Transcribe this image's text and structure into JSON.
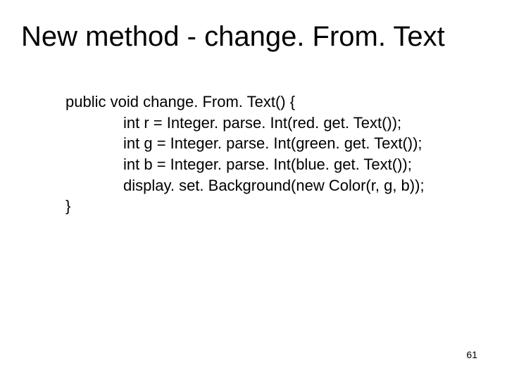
{
  "title": "New method - change. From. Text",
  "code": {
    "line1": "public void change. From. Text() {",
    "line2": "int r = Integer. parse. Int(red. get. Text());",
    "line3": "int g = Integer. parse. Int(green. get. Text());",
    "line4": "int b = Integer. parse. Int(blue. get. Text());",
    "line5": "display. set. Background(new Color(r, g, b));",
    "line6": "}"
  },
  "page_number": "61"
}
